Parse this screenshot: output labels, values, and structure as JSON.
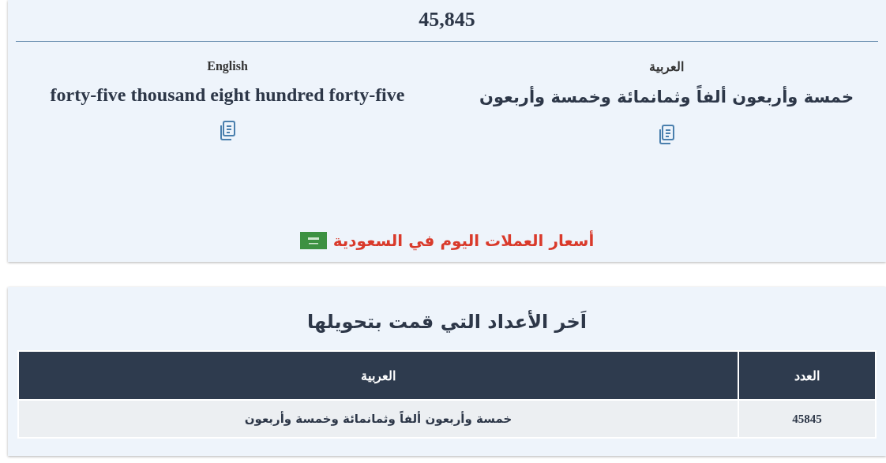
{
  "number": "45,845",
  "translations": [
    {
      "kind": "arabic",
      "language": "العربية",
      "text": "خمسة وأربعون ألفاً وثمانمائة وخمسة وأربعون"
    },
    {
      "kind": "english",
      "language": "English",
      "text": "forty-five thousand eight hundred forty-five"
    }
  ],
  "currency_link": "أسعار العملات اليوم في السعودية",
  "history": {
    "title": "اَخر الأعداد التي قمت بتحويلها",
    "columns": [
      "العدد",
      "العربية"
    ],
    "rows": [
      [
        "45845",
        "خمسة وأربعون ألفاً وثمانمائة وخمسة وأربعون"
      ]
    ]
  }
}
